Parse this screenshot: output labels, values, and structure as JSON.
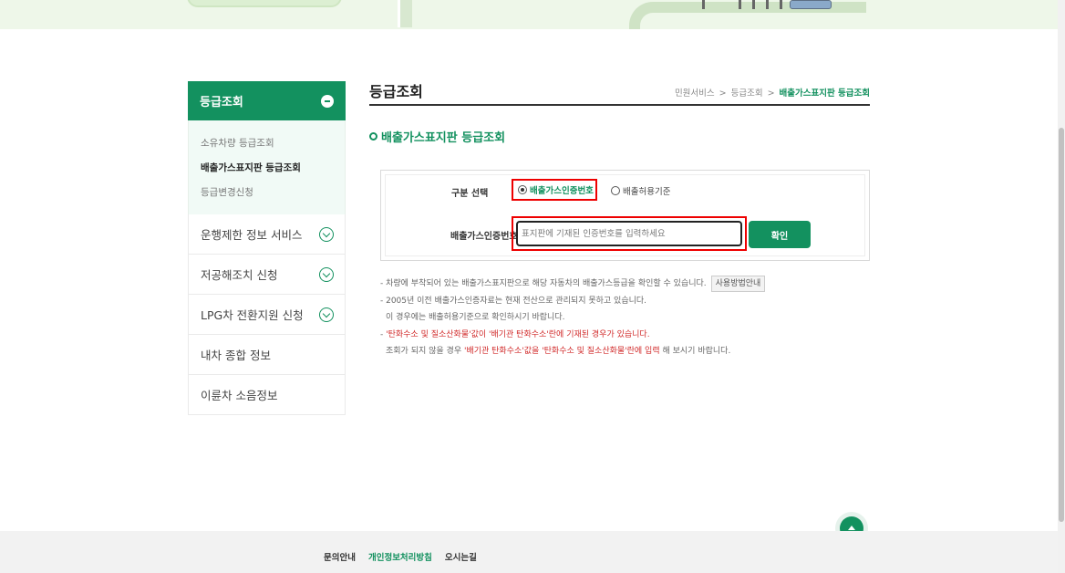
{
  "sidebar": {
    "head_label": "등급조회",
    "sub_items": [
      "소유차량 등급조회",
      "배출가스표지판 등급조회",
      "등급변경신청"
    ],
    "items": [
      "운행제한 정보 서비스",
      "저공해조치 신청",
      "LPG차 전환지원 신청",
      "내차 종합 정보",
      "이륜차 소음정보"
    ]
  },
  "main": {
    "title": "등급조회",
    "breadcrumb": {
      "first": "민원서비스",
      "second": "등급조회",
      "current": "배출가스표지판 등급조회",
      "sep": ">"
    },
    "section_title": "배출가스표지판 등급조회"
  },
  "form": {
    "select_label": "구분 선택",
    "radio_option1": "배출가스인증번호",
    "radio_option2": "배출허용기준",
    "input_label": "배출가스인증번호",
    "input_placeholder": "표지판에 기재된 인증번호를 입력하세요",
    "confirm_label": "확인"
  },
  "notes": {
    "line1": "- 차량에 부착되어 있는 배출가스표지판으로 해당 자동차의 배출가스등급을 확인할 수 있습니다.",
    "guide_button": "사용방법안내",
    "line2": "- 2005년 이전 배출가스인증자료는 현재 전산으로 관리되지 못하고 있습니다.",
    "line3": "이 경우에는 배출허용기준으로 확인하시기 바랍니다.",
    "line4_prefix": "- ",
    "line4_red": "'탄화수소 및 질소산화물'값이 '배기관 탄화수소'란에 기재된 경우가 있습니다.",
    "line5_a": "조회가 되지 않을 경우 ",
    "line5_red": "'배기관 탄화수소'값을 '탄화수소 및 질소산화물'란에 입력",
    "line5_b": " 해 보시기 바랍니다."
  },
  "footer": {
    "link1": "문의안내",
    "link2": "개인정보처리방침",
    "link3": "오시는길"
  },
  "colors": {
    "accent": "#13915f",
    "highlight": "#e00000"
  }
}
